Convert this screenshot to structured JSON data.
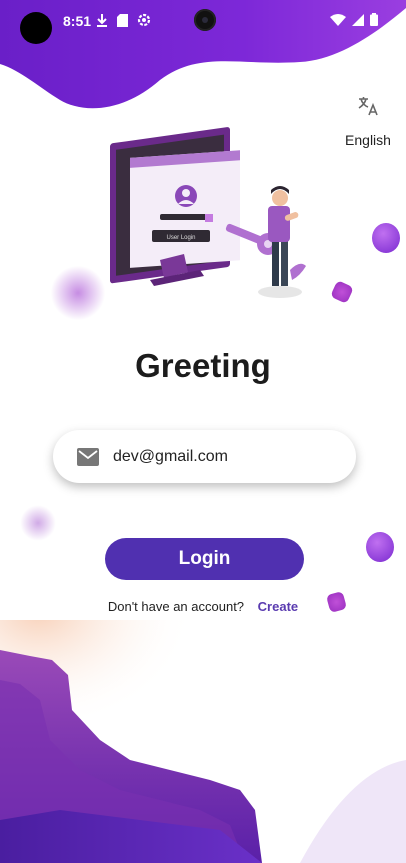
{
  "status_bar": {
    "time": "8:51",
    "left_icons": [
      "download-icon",
      "sd-card-icon",
      "settings-icon"
    ],
    "right_icons": [
      "wifi-icon",
      "signal-icon",
      "battery-icon"
    ]
  },
  "language": {
    "icon": "translate-icon",
    "label": "English"
  },
  "illustration": {
    "screen_label": "User Login"
  },
  "title": "Greeting",
  "email_field": {
    "icon": "mail-icon",
    "value": "dev@gmail.com"
  },
  "login_button": {
    "label": "Login"
  },
  "signup": {
    "prompt": "Don't have an account?",
    "link": "Create"
  },
  "colors": {
    "primary": "#5030b0",
    "accent": "#7a2ad6",
    "blob": "#a040d0"
  }
}
